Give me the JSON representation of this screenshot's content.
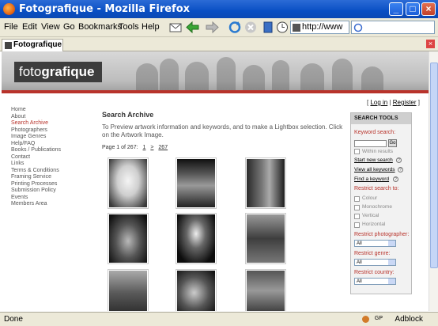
{
  "window": {
    "title": "Fotografique - Mozilla Firefox"
  },
  "menu": [
    "File",
    "Edit",
    "View",
    "Go",
    "Bookmarks",
    "Tools",
    "Help"
  ],
  "address": {
    "value": "http://www"
  },
  "tab": {
    "label": "Fotografique"
  },
  "site": {
    "logo_prefix": "foto",
    "logo_suffix": "grafique",
    "login": "Log in",
    "register": "Register"
  },
  "nav": {
    "items": [
      "Home",
      "About",
      "Search Archive",
      "Photographers",
      "Image Genres",
      "Help/FAQ",
      "Books / Publications",
      "Contact",
      "Links",
      "Terms & Conditions",
      "Framing Service",
      "Printing Processes",
      "Submission Policy",
      "Events",
      "Members Area"
    ]
  },
  "content": {
    "title": "Search Archive",
    "intro": "To Preview artwork information and keywords, and to make a Lightbox selection. Click on the Artwork Image.",
    "page_label": "Page 1 of 267:",
    "page_first": "1",
    "page_next": ">",
    "page_last": "267"
  },
  "tools": {
    "header": "SEARCH TOOLS",
    "keyword_label": "Keyword search:",
    "go": "Go",
    "within_results": "Within results",
    "start_new_search": "Start new search",
    "view_all_keywords": "View all keywords",
    "find_keyword": "Find a keyword",
    "restrict_search": "Restrict search to:",
    "options": [
      "Colour",
      "Monochrome",
      "Vertical",
      "Horizontal"
    ],
    "restrict_photographer": "Restrict photographer:",
    "restrict_genre": "Restrict genre:",
    "restrict_country": "Restrict country:",
    "select_value": "All"
  },
  "status": {
    "text": "Done",
    "gp": "GP",
    "adblock": "Adblock"
  }
}
